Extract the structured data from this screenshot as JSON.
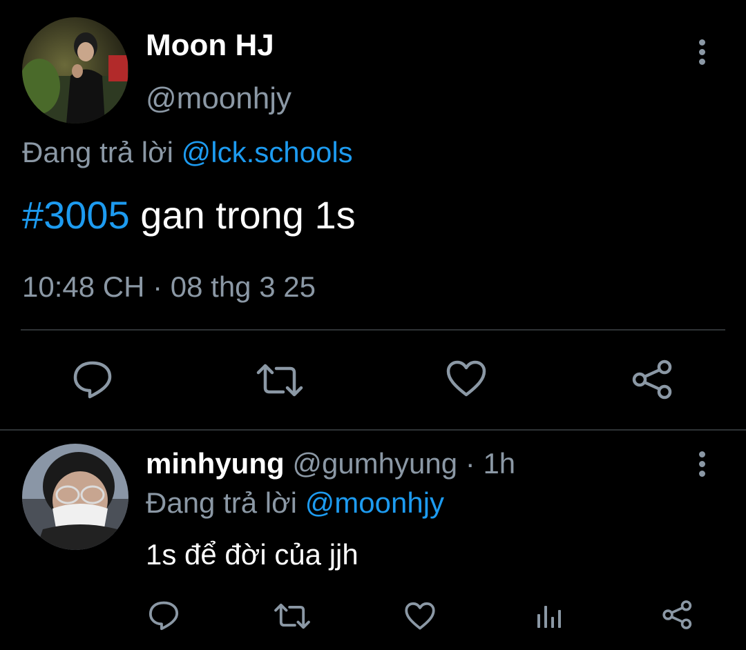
{
  "main_tweet": {
    "display_name": "Moon HJ",
    "handle": "@moonhjy",
    "replying_prefix": "Đang trả lời",
    "replying_to": "@lck.schools",
    "hashtag": "#3005",
    "text": " gan trong 1s",
    "timestamp": "10:48 CH · 08 thg 3 25",
    "actions": [
      "reply-icon",
      "retweet-icon",
      "like-icon",
      "share-icon"
    ]
  },
  "reply_tweet": {
    "display_name": "minhyung",
    "handle": "@gumhyung",
    "separator": " · ",
    "time_ago": "1h",
    "replying_prefix": "Đang trả lời",
    "replying_to": "@moonhjy",
    "text": "1s để đời của jjh",
    "actions": [
      "reply-icon",
      "retweet-icon",
      "like-icon",
      "analytics-icon",
      "share-icon"
    ]
  },
  "colors": {
    "background": "#000000",
    "text": "#ffffff",
    "muted": "#8b98a5",
    "accent": "#1d9bf0",
    "divider": "#2f3336"
  }
}
